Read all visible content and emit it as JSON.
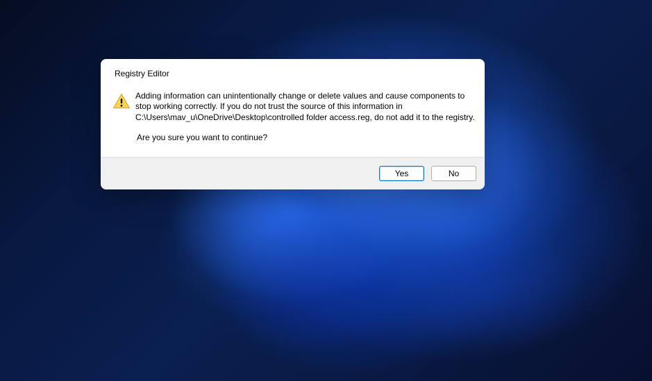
{
  "dialog": {
    "title": "Registry Editor",
    "warning_message": "Adding information can unintentionally change or delete values and cause components to stop working correctly. If you do not trust the source of this information in C:\\Users\\mav_u\\OneDrive\\Desktop\\controlled folder access.reg, do not add it to the registry.",
    "confirm_message": "Are you sure you want to continue?",
    "buttons": {
      "yes": "Yes",
      "no": "No"
    }
  }
}
